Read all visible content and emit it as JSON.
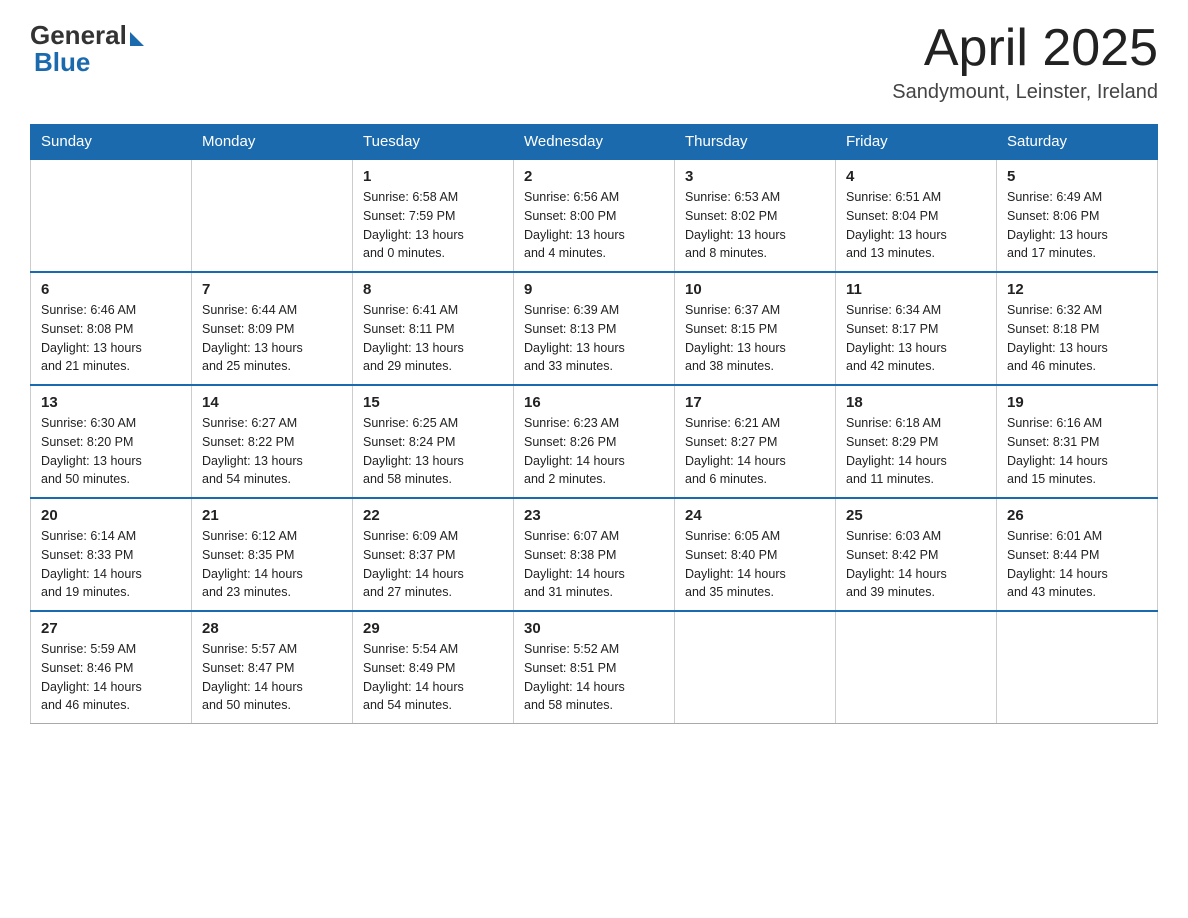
{
  "header": {
    "logo_general": "General",
    "logo_blue": "Blue",
    "month_year": "April 2025",
    "location": "Sandymount, Leinster, Ireland"
  },
  "days_of_week": [
    "Sunday",
    "Monday",
    "Tuesday",
    "Wednesday",
    "Thursday",
    "Friday",
    "Saturday"
  ],
  "weeks": [
    [
      {
        "day": "",
        "info": ""
      },
      {
        "day": "",
        "info": ""
      },
      {
        "day": "1",
        "info": "Sunrise: 6:58 AM\nSunset: 7:59 PM\nDaylight: 13 hours\nand 0 minutes."
      },
      {
        "day": "2",
        "info": "Sunrise: 6:56 AM\nSunset: 8:00 PM\nDaylight: 13 hours\nand 4 minutes."
      },
      {
        "day": "3",
        "info": "Sunrise: 6:53 AM\nSunset: 8:02 PM\nDaylight: 13 hours\nand 8 minutes."
      },
      {
        "day": "4",
        "info": "Sunrise: 6:51 AM\nSunset: 8:04 PM\nDaylight: 13 hours\nand 13 minutes."
      },
      {
        "day": "5",
        "info": "Sunrise: 6:49 AM\nSunset: 8:06 PM\nDaylight: 13 hours\nand 17 minutes."
      }
    ],
    [
      {
        "day": "6",
        "info": "Sunrise: 6:46 AM\nSunset: 8:08 PM\nDaylight: 13 hours\nand 21 minutes."
      },
      {
        "day": "7",
        "info": "Sunrise: 6:44 AM\nSunset: 8:09 PM\nDaylight: 13 hours\nand 25 minutes."
      },
      {
        "day": "8",
        "info": "Sunrise: 6:41 AM\nSunset: 8:11 PM\nDaylight: 13 hours\nand 29 minutes."
      },
      {
        "day": "9",
        "info": "Sunrise: 6:39 AM\nSunset: 8:13 PM\nDaylight: 13 hours\nand 33 minutes."
      },
      {
        "day": "10",
        "info": "Sunrise: 6:37 AM\nSunset: 8:15 PM\nDaylight: 13 hours\nand 38 minutes."
      },
      {
        "day": "11",
        "info": "Sunrise: 6:34 AM\nSunset: 8:17 PM\nDaylight: 13 hours\nand 42 minutes."
      },
      {
        "day": "12",
        "info": "Sunrise: 6:32 AM\nSunset: 8:18 PM\nDaylight: 13 hours\nand 46 minutes."
      }
    ],
    [
      {
        "day": "13",
        "info": "Sunrise: 6:30 AM\nSunset: 8:20 PM\nDaylight: 13 hours\nand 50 minutes."
      },
      {
        "day": "14",
        "info": "Sunrise: 6:27 AM\nSunset: 8:22 PM\nDaylight: 13 hours\nand 54 minutes."
      },
      {
        "day": "15",
        "info": "Sunrise: 6:25 AM\nSunset: 8:24 PM\nDaylight: 13 hours\nand 58 minutes."
      },
      {
        "day": "16",
        "info": "Sunrise: 6:23 AM\nSunset: 8:26 PM\nDaylight: 14 hours\nand 2 minutes."
      },
      {
        "day": "17",
        "info": "Sunrise: 6:21 AM\nSunset: 8:27 PM\nDaylight: 14 hours\nand 6 minutes."
      },
      {
        "day": "18",
        "info": "Sunrise: 6:18 AM\nSunset: 8:29 PM\nDaylight: 14 hours\nand 11 minutes."
      },
      {
        "day": "19",
        "info": "Sunrise: 6:16 AM\nSunset: 8:31 PM\nDaylight: 14 hours\nand 15 minutes."
      }
    ],
    [
      {
        "day": "20",
        "info": "Sunrise: 6:14 AM\nSunset: 8:33 PM\nDaylight: 14 hours\nand 19 minutes."
      },
      {
        "day": "21",
        "info": "Sunrise: 6:12 AM\nSunset: 8:35 PM\nDaylight: 14 hours\nand 23 minutes."
      },
      {
        "day": "22",
        "info": "Sunrise: 6:09 AM\nSunset: 8:37 PM\nDaylight: 14 hours\nand 27 minutes."
      },
      {
        "day": "23",
        "info": "Sunrise: 6:07 AM\nSunset: 8:38 PM\nDaylight: 14 hours\nand 31 minutes."
      },
      {
        "day": "24",
        "info": "Sunrise: 6:05 AM\nSunset: 8:40 PM\nDaylight: 14 hours\nand 35 minutes."
      },
      {
        "day": "25",
        "info": "Sunrise: 6:03 AM\nSunset: 8:42 PM\nDaylight: 14 hours\nand 39 minutes."
      },
      {
        "day": "26",
        "info": "Sunrise: 6:01 AM\nSunset: 8:44 PM\nDaylight: 14 hours\nand 43 minutes."
      }
    ],
    [
      {
        "day": "27",
        "info": "Sunrise: 5:59 AM\nSunset: 8:46 PM\nDaylight: 14 hours\nand 46 minutes."
      },
      {
        "day": "28",
        "info": "Sunrise: 5:57 AM\nSunset: 8:47 PM\nDaylight: 14 hours\nand 50 minutes."
      },
      {
        "day": "29",
        "info": "Sunrise: 5:54 AM\nSunset: 8:49 PM\nDaylight: 14 hours\nand 54 minutes."
      },
      {
        "day": "30",
        "info": "Sunrise: 5:52 AM\nSunset: 8:51 PM\nDaylight: 14 hours\nand 58 minutes."
      },
      {
        "day": "",
        "info": ""
      },
      {
        "day": "",
        "info": ""
      },
      {
        "day": "",
        "info": ""
      }
    ]
  ]
}
